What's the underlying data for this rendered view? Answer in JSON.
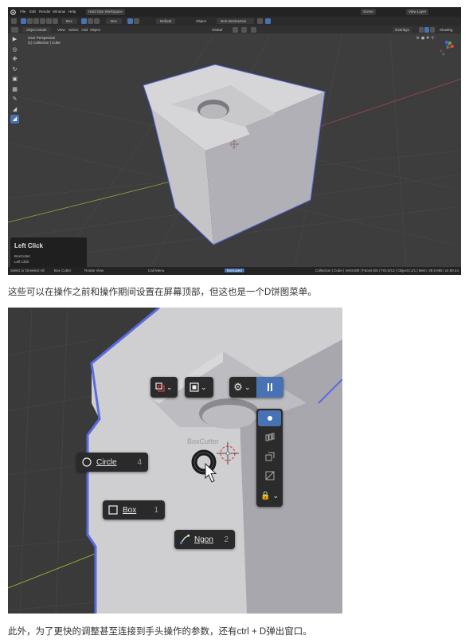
{
  "screenshot1": {
    "menus": [
      "File",
      "Edit",
      "Render",
      "Window",
      "Help"
    ],
    "workspace_tab": "Hard Ops Workspace",
    "scene_label": "Scene",
    "view_layer_label": "View Layer",
    "header2": {
      "mode_items": [
        "Cut",
        "Box"
      ],
      "orientation": "Default",
      "object_label": "Object",
      "snap_label": "Non-Destructive"
    },
    "header3": {
      "object_mode": "Object Mode",
      "menus": [
        "View",
        "Select",
        "Add",
        "Object"
      ],
      "transform": "Global",
      "overlays": "Overlays",
      "shading": "Shading"
    },
    "viewport_info": [
      "User Perspective",
      "(1) Collection | Cube"
    ],
    "last_operator": {
      "title": "Left Click",
      "lines": [
        "BoxCutter",
        "Left Click"
      ]
    },
    "status_bar": {
      "items": [
        "Select or Deselect All",
        "Box Cutter",
        "Rotate View",
        "Call Menu",
        "Executed"
      ],
      "right": "Collection | Cube | Verts:8/8 | Faces:6/6 | Tris:0/12 | Objects:1/1 | Mem: 49.9 MB | v2.80.44"
    }
  },
  "caption1": "这些可以在操作之前和操作期间设置在屏幕顶部，但这也是一个D饼图菜单。",
  "screenshot2": {
    "tool_name": "BoxCutter",
    "pie_items": [
      {
        "label": "Circle",
        "key": "4"
      },
      {
        "label": "Box",
        "key": "1"
      },
      {
        "label": "Ngon",
        "key": "2"
      }
    ]
  },
  "caption2": "此外，为了更快的调整甚至连接到手头操作的参数，还有ctrl + D弹出窗口。",
  "colors": {
    "accent": "#4772b3",
    "cube_face": "#c9c9cc",
    "outline": "#5566dd",
    "viewport_bg": "#3d3d3d"
  }
}
